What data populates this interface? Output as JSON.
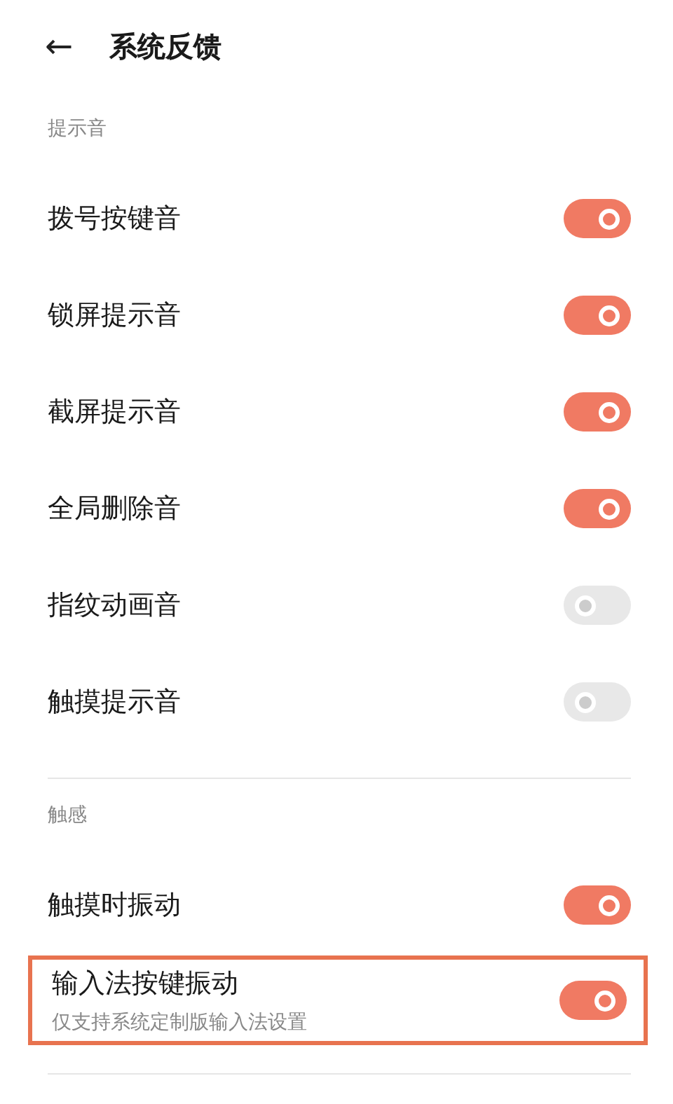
{
  "header": {
    "back": "←",
    "title": "系统反馈"
  },
  "sections": [
    {
      "title": "提示音",
      "items": [
        {
          "label": "拨号按键音",
          "on": true,
          "highlighted": false
        },
        {
          "label": "锁屏提示音",
          "on": true,
          "highlighted": false
        },
        {
          "label": "截屏提示音",
          "on": true,
          "highlighted": false
        },
        {
          "label": "全局删除音",
          "on": true,
          "highlighted": false
        },
        {
          "label": "指纹动画音",
          "on": false,
          "highlighted": false
        },
        {
          "label": "触摸提示音",
          "on": false,
          "highlighted": false
        }
      ]
    },
    {
      "title": "触感",
      "items": [
        {
          "label": "触摸时振动",
          "on": true,
          "highlighted": false
        },
        {
          "label": "输入法按键振动",
          "subtitle": "仅支持系统定制版输入法设置",
          "on": true,
          "highlighted": true
        }
      ]
    }
  ]
}
